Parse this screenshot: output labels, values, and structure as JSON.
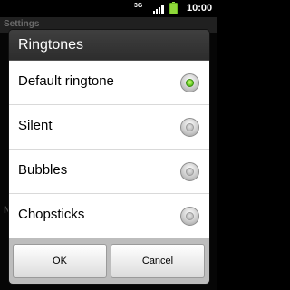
{
  "status_bar": {
    "network": "3G",
    "time": "10:00",
    "icons": [
      "signal-icon",
      "battery-icon"
    ]
  },
  "background": {
    "header_title": "Settings",
    "partial_letter": "N"
  },
  "dialog": {
    "title": "Ringtones",
    "options": [
      {
        "label": "Default ringtone",
        "checked": true
      },
      {
        "label": "Silent",
        "checked": false
      },
      {
        "label": "Bubbles",
        "checked": false
      },
      {
        "label": "Chopsticks",
        "checked": false
      }
    ],
    "ok_label": "OK",
    "cancel_label": "Cancel"
  },
  "colors": {
    "accent_green": "#55c21b",
    "dialog_title_bg": "#2d2d2d",
    "button_bar_bg": "#bdbdbd"
  }
}
